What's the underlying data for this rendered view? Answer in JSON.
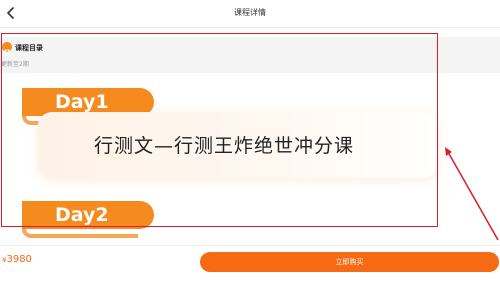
{
  "header": {
    "title": "课程详情",
    "back_icon": "chevron-left-icon"
  },
  "catalog": {
    "icon": "grid-icon",
    "title": "课程目录",
    "subtitle": "更新至2期"
  },
  "lessons": [
    {
      "day": "Day1",
      "title": "行测文—行测王炸绝世冲分课"
    },
    {
      "day": "Day2",
      "title": ""
    }
  ],
  "footer": {
    "price_symbol": "¥",
    "price": "3980",
    "buy_label": "立即购买"
  },
  "colors": {
    "accent": "#f58a1f",
    "buy_button": "#f56a12",
    "annotation": "#d81e2c"
  }
}
